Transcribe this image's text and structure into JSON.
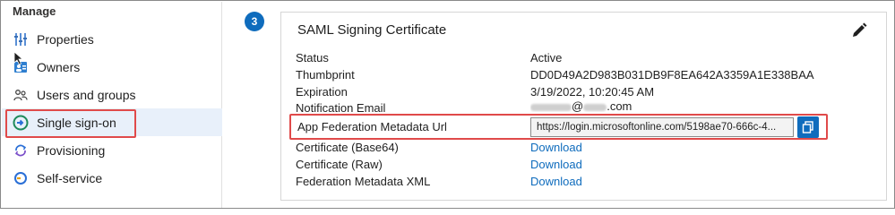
{
  "sidebar": {
    "section_title": "Manage",
    "items": [
      {
        "label": "Properties",
        "icon": "properties-icon"
      },
      {
        "label": "Owners",
        "icon": "owners-icon"
      },
      {
        "label": "Users and groups",
        "icon": "users-groups-icon"
      },
      {
        "label": "Single sign-on",
        "icon": "single-sign-on-icon",
        "active": true
      },
      {
        "label": "Provisioning",
        "icon": "provisioning-icon"
      },
      {
        "label": "Self-service",
        "icon": "self-service-icon"
      }
    ]
  },
  "step": {
    "number": "3"
  },
  "card": {
    "title": "SAML Signing Certificate",
    "rows": {
      "status": {
        "label": "Status",
        "value": "Active"
      },
      "thumbprint": {
        "label": "Thumbprint",
        "value": "DD0D49A2D983B031DB9F8EA642A3359A1E338BAA"
      },
      "expiration": {
        "label": "Expiration",
        "value": "3/19/2022, 10:20:45 AM"
      },
      "notification_email": {
        "label": "Notification Email",
        "value_at": "@",
        "value_suffix": ".com"
      },
      "metadata_url": {
        "label": "App Federation Metadata Url",
        "value": "https://login.microsoftonline.com/5198ae70-666c-4..."
      },
      "cert_base64": {
        "label": "Certificate (Base64)",
        "value": "Download"
      },
      "cert_raw": {
        "label": "Certificate (Raw)",
        "value": "Download"
      },
      "federation_xml": {
        "label": "Federation Metadata XML",
        "value": "Download"
      }
    }
  },
  "colors": {
    "accent": "#0f6cbd",
    "highlight": "#e04a4a",
    "active_bg": "#e8f0fa"
  }
}
